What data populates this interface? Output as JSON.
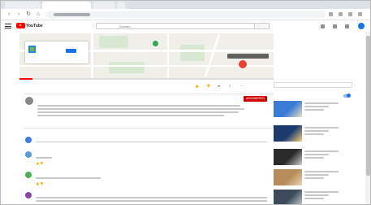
{
  "browser": {
    "tabs": [
      "",
      "",
      "",
      ""
    ],
    "url": "",
    "colors": {
      "tabbar": "#dee1e6",
      "omnibox": "#f1f3f4"
    }
  },
  "header": {
    "logo_text": "YouTube",
    "search_placeholder": "Suchen",
    "icons": [
      "menu-icon",
      "search-icon",
      "create-icon",
      "apps-icon",
      "notifications-icon",
      "avatar"
    ]
  },
  "player": {
    "overlay_card": {
      "title": "",
      "button": ""
    },
    "overlay_banner": "",
    "progress": 0.05,
    "colors": {
      "map": "#f1efe9",
      "park": "#d8e8d2",
      "pin_green": "#34a853",
      "pin_red": "#ea4335",
      "progress": "#ff0000"
    }
  },
  "video": {
    "title": "",
    "meta": "",
    "actions": [
      "",
      "",
      "",
      "",
      ""
    ]
  },
  "channel": {
    "name": "",
    "subscribe_label": "ABONNIEREN",
    "description_lines": 4,
    "show_more": ""
  },
  "comments": {
    "count_label": "",
    "sort_label": "",
    "add_placeholder": "",
    "items": [
      {
        "author": "",
        "text": "",
        "actions": ""
      },
      {
        "author": "",
        "text": "",
        "actions": ""
      },
      {
        "author": "",
        "text": "",
        "actions": ""
      }
    ],
    "avatar_colors": [
      "#3d7de8",
      "#5b9bd5",
      "#4caf50",
      "#8e44ad"
    ]
  },
  "sidebar": {
    "ad_label": "",
    "up_next": "",
    "autoplay_label": "",
    "videos": [
      {
        "title": "",
        "duration": "",
        "colors": [
          "#3a7bd5",
          "#e8e2c8"
        ]
      },
      {
        "title": "",
        "duration": "",
        "colors": [
          "#1b3b6f",
          "#f5d27a"
        ]
      },
      {
        "title": "",
        "duration": "",
        "colors": [
          "#2a2a2a",
          "#d0d0d0"
        ]
      },
      {
        "title": "",
        "duration": "",
        "colors": [
          "#b58c5a",
          "#e9d7b5"
        ]
      },
      {
        "title": "",
        "duration": "",
        "colors": [
          "#3c4a5c",
          "#c9ccd1"
        ]
      }
    ]
  }
}
